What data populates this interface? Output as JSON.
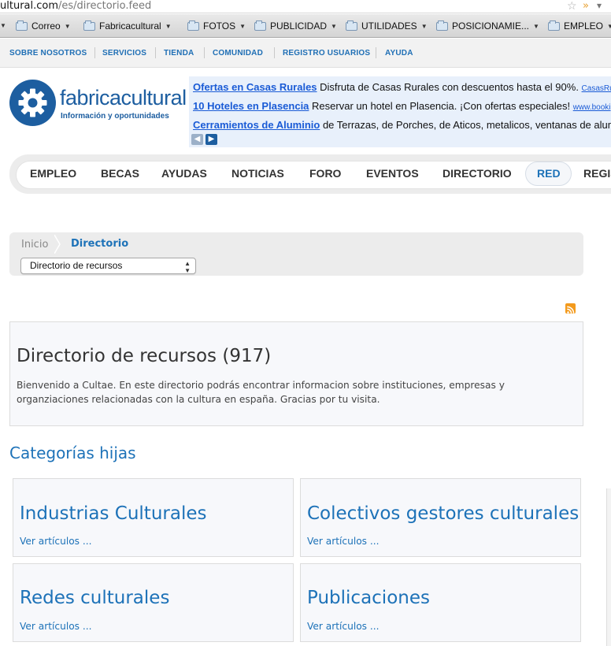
{
  "browser": {
    "url_host": "ultural.com",
    "url_path": "/es/directorio.feed"
  },
  "bookmarks": [
    {
      "label": "Correo"
    },
    {
      "label": "Fabricacultural"
    },
    {
      "label": "FOTOS"
    },
    {
      "label": "PUBLICIDAD"
    },
    {
      "label": "UTILIDADES"
    },
    {
      "label": "POSICIONAMIE..."
    },
    {
      "label": "EMPLEO"
    }
  ],
  "topnav": [
    {
      "label": "SOBRE NOSOTROS"
    },
    {
      "label": "SERVICIOS"
    },
    {
      "label": "TIENDA"
    },
    {
      "label": "COMUNIDAD"
    },
    {
      "label": "REGISTRO USUARIOS"
    },
    {
      "label": "AYUDA"
    }
  ],
  "logo": {
    "text": "fabricacultural",
    "tagline": "Información y oportunidades"
  },
  "ads": [
    {
      "title": "Ofertas en Casas Rurales",
      "text": " Disfruta de Casas Rurales con descuentos hasta el 90%. ",
      "url": "CasasRu"
    },
    {
      "title": "10 Hoteles en Plasencia",
      "text": " Reservar un hotel en Plasencia. ¡Con ofertas especiales! ",
      "url": "www.booki"
    },
    {
      "title": "Cerramientos de Aluminio",
      "text": " de Terrazas, de Porches, de Aticos, metalicos, ventanas de alum",
      "url": ""
    }
  ],
  "mainnav": [
    {
      "label": "EMPLEO"
    },
    {
      "label": "BECAS"
    },
    {
      "label": "AYUDAS"
    },
    {
      "label": "NOTICIAS"
    },
    {
      "label": "FORO"
    },
    {
      "label": "EVENTOS"
    },
    {
      "label": "DIRECTORIO"
    },
    {
      "label": "RED"
    },
    {
      "label": "REGIS"
    }
  ],
  "breadcrumb": {
    "home": "Inicio",
    "current": "Directorio"
  },
  "select": {
    "value": "Directorio de recursos"
  },
  "directory": {
    "title": "Directorio de recursos (917)",
    "description": "Bienvenido a Cultae. En este directorio podrás encontrar informacion sobre instituciones, empresas y organziaciones relacionadas con la cultura en españa. Gracias por tu visita."
  },
  "subcategories_heading": "Categorías hijas",
  "categories": [
    {
      "title": "Industrias Culturales",
      "link": "Ver artículos ..."
    },
    {
      "title": "Colectivos gestores culturales",
      "link": "Ver artículos ..."
    },
    {
      "title": "Redes culturales",
      "link": "Ver artículos ..."
    },
    {
      "title": "Publicaciones",
      "link": "Ver artículos ..."
    }
  ],
  "colors": {
    "accent": "#1d72b8",
    "logo": "#1d5ea0",
    "ad_link": "#1a5bd6",
    "rss": "#f39a1c"
  }
}
